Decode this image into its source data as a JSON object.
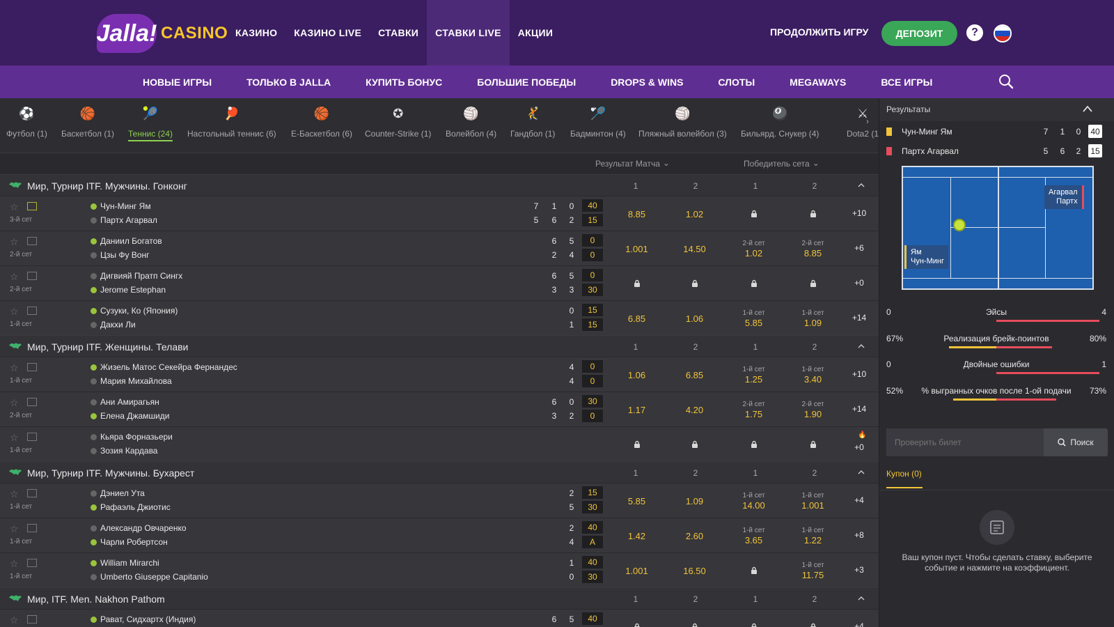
{
  "brand": {
    "logo_word": "Jalla!",
    "logo_casino": "CASINO"
  },
  "topnav": [
    "КАЗИНО",
    "КАЗИНО LIVE",
    "СТАВКИ",
    "СТАВКИ LIVE",
    "АКЦИИ"
  ],
  "header": {
    "continue": "ПРОДОЛЖИТЬ ИГРУ",
    "deposit": "ДЕПОЗИТ",
    "help": "?"
  },
  "subnav": [
    "НОВЫЕ ИГРЫ",
    "ТОЛЬКО В JALLA",
    "КУПИТЬ БОНУС",
    "БОЛЬШИЕ ПОБЕДЫ",
    "DROPS & WINS",
    "СЛОТЫ",
    "MEGAWAYS",
    "ВСЕ ИГРЫ"
  ],
  "sports": [
    {
      "label": "Футбол (1)",
      "icon": "⚽",
      "color": "#ffffff"
    },
    {
      "label": "Баскетбол (1)",
      "icon": "🏀",
      "color": "#e67e22"
    },
    {
      "label": "Теннис (24)",
      "icon": "🎾",
      "color": "#9ac43a"
    },
    {
      "label": "Настольный теннис (6)",
      "icon": "🏓",
      "color": "#e74c3c"
    },
    {
      "label": "Е-Баскетбол (6)",
      "icon": "🏀",
      "color": "#e67e22"
    },
    {
      "label": "Counter-Strike (1)",
      "icon": "✪",
      "color": "#dddddd"
    },
    {
      "label": "Волейбол (4)",
      "icon": "🏐",
      "color": "#3498db"
    },
    {
      "label": "Гандбол (1)",
      "icon": "🤾",
      "color": "#ffffff"
    },
    {
      "label": "Бадминтон (4)",
      "icon": "🏸",
      "color": "#ffffff"
    },
    {
      "label": "Пляжный волейбол (3)",
      "icon": "🏐",
      "color": "#f1c40f"
    },
    {
      "label": "Бильярд. Снукер (4)",
      "icon": "🎱",
      "color": "#e74c3c"
    },
    {
      "label": "Dota2 (1",
      "icon": "⚔",
      "color": "#dddddd"
    }
  ],
  "markets": {
    "match_result": "Результат Матча",
    "set_winner": "Победитель сета"
  },
  "cols": {
    "c1": "1",
    "c2": "2"
  },
  "tournaments": [
    {
      "name": "Мир, Турнир ITF. Мужчины. Гонконг",
      "matches": [
        {
          "set": "3-й сет",
          "p1": "Чун-Минг Ям",
          "p2": "Партх Агарвал",
          "s1": [
            "7",
            "1",
            "0"
          ],
          "s2": [
            "5",
            "6",
            "2"
          ],
          "pt1": "40",
          "pt2": "15",
          "serve": 1,
          "live": true,
          "odds": [
            {
              "v": "8.85"
            },
            {
              "v": "1.02"
            },
            {
              "lock": true
            },
            {
              "lock": true
            }
          ],
          "more": "+10"
        },
        {
          "set": "2-й сет",
          "p1": "Даниил Богатов",
          "p2": "Цзы Фу Вонг",
          "s1": [
            "6",
            "5"
          ],
          "s2": [
            "2",
            "4"
          ],
          "pt1": "0",
          "pt2": "0",
          "serve": 1,
          "odds": [
            {
              "v": "1.001"
            },
            {
              "v": "14.50"
            },
            {
              "sub": "2-й сет",
              "v": "1.02"
            },
            {
              "sub": "2-й сет",
              "v": "8.85"
            }
          ],
          "more": "+6"
        },
        {
          "set": "2-й сет",
          "p1": "Дигвияй Пратп Сингх",
          "p2": "Jerome Estephan",
          "s1": [
            "6",
            "5"
          ],
          "s2": [
            "3",
            "3"
          ],
          "pt1": "0",
          "pt2": "30",
          "serve": 2,
          "odds": [
            {
              "lock": true
            },
            {
              "lock": true
            },
            {
              "lock": true
            },
            {
              "lock": true
            }
          ],
          "more": "+0"
        },
        {
          "set": "1-й сет",
          "p1": "Сузуки, Ко (Япония)",
          "p2": "Дакхи Ли",
          "s1": [
            "0"
          ],
          "s2": [
            "1"
          ],
          "pt1": "15",
          "pt2": "15",
          "serve": 1,
          "odds": [
            {
              "v": "6.85"
            },
            {
              "v": "1.06"
            },
            {
              "sub": "1-й сет",
              "v": "5.85"
            },
            {
              "sub": "1-й сет",
              "v": "1.09"
            }
          ],
          "more": "+14"
        }
      ]
    },
    {
      "name": "Мир, Турнир ITF. Женщины. Телави",
      "matches": [
        {
          "set": "1-й сет",
          "p1": "Жизель Матос Секейра Фернандес",
          "p2": "Мария Михайлова",
          "s1": [
            "4"
          ],
          "s2": [
            "4"
          ],
          "pt1": "0",
          "pt2": "0",
          "serve": 1,
          "odds": [
            {
              "v": "1.06"
            },
            {
              "v": "6.85"
            },
            {
              "sub": "1-й сет",
              "v": "1.25"
            },
            {
              "sub": "1-й сет",
              "v": "3.40"
            }
          ],
          "more": "+10"
        },
        {
          "set": "2-й сет",
          "p1": "Ани Амирагьян",
          "p2": "Елена Джамшиди",
          "s1": [
            "6",
            "0"
          ],
          "s2": [
            "3",
            "2"
          ],
          "pt1": "30",
          "pt2": "0",
          "serve": 2,
          "odds": [
            {
              "v": "1.17"
            },
            {
              "v": "4.20"
            },
            {
              "sub": "2-й сет",
              "v": "1.75"
            },
            {
              "sub": "2-й сет",
              "v": "1.90"
            }
          ],
          "more": "+14"
        },
        {
          "set": "1-й сет",
          "p1": "Кьяра Форназьери",
          "p2": "Зозия Кардава",
          "s1": [],
          "s2": [],
          "pt1": "",
          "pt2": "",
          "serve": 0,
          "odds": [
            {
              "lock": true
            },
            {
              "lock": true
            },
            {
              "lock": true
            },
            {
              "lock": true
            }
          ],
          "more": "+0",
          "fire": true
        }
      ]
    },
    {
      "name": "Мир, Турнир ITF. Мужчины. Бухарест",
      "matches": [
        {
          "set": "1-й сет",
          "p1": "Дэниел Ута",
          "p2": "Рафаэль Джиотис",
          "s1": [
            "2"
          ],
          "s2": [
            "5"
          ],
          "pt1": "15",
          "pt2": "30",
          "serve": 2,
          "odds": [
            {
              "v": "5.85"
            },
            {
              "v": "1.09"
            },
            {
              "sub": "1-й сет",
              "v": "14.00"
            },
            {
              "sub": "1-й сет",
              "v": "1.001"
            }
          ],
          "more": "+4"
        },
        {
          "set": "1-й сет",
          "p1": "Александр Овчаренко",
          "p2": "Чарли Робертсон",
          "s1": [
            "2"
          ],
          "s2": [
            "4"
          ],
          "pt1": "40",
          "pt2": "A",
          "serve": 2,
          "odds": [
            {
              "v": "1.42"
            },
            {
              "v": "2.60"
            },
            {
              "sub": "1-й сет",
              "v": "3.65"
            },
            {
              "sub": "1-й сет",
              "v": "1.22"
            }
          ],
          "more": "+8"
        },
        {
          "set": "1-й сет",
          "p1": "William Mirarchi",
          "p2": "Umberto Giuseppe Capitanio",
          "s1": [
            "1"
          ],
          "s2": [
            "0"
          ],
          "pt1": "40",
          "pt2": "30",
          "serve": 1,
          "odds": [
            {
              "v": "1.001"
            },
            {
              "v": "16.50"
            },
            {
              "lock": true
            },
            {
              "sub": "1-й сет",
              "v": "11.75"
            }
          ],
          "more": "+3"
        }
      ]
    },
    {
      "name": "Мир, ITF. Men. Nakhon Pathom",
      "matches": [
        {
          "set": "",
          "p1": "Рават, Сидхартх (Индия)",
          "p2": "",
          "s1": [
            "6",
            "5"
          ],
          "s2": [],
          "pt1": "40",
          "pt2": "",
          "serve": 1,
          "odds": [
            {
              "lock": true
            },
            {
              "lock": true
            },
            {
              "lock": true
            },
            {
              "lock": true
            }
          ],
          "more": "+4"
        }
      ]
    }
  ],
  "results": {
    "title": "Результаты",
    "p1": {
      "name": "Чун-Минг Ям",
      "sets": [
        "7",
        "1",
        "0"
      ],
      "pt": "40",
      "color": "#f2c43a"
    },
    "p2": {
      "name": "Партх Агарвал",
      "sets": [
        "5",
        "6",
        "2"
      ],
      "pt": "15",
      "color": "#e74c5c"
    },
    "court": {
      "right_l1": "Агарвал",
      "right_l2": "Партх",
      "left_l1": "Ям",
      "left_l2": "Чун-Минг"
    },
    "stats": [
      {
        "label": "Эйсы",
        "l": "0",
        "r": "4",
        "lp": 0,
        "rp": 1
      },
      {
        "label": "Реализация брейк-поинтов",
        "l": "67%",
        "r": "80%",
        "lp": 0.46,
        "rp": 0.54
      },
      {
        "label": "Двойные ошибки",
        "l": "0",
        "r": "1",
        "lp": 0,
        "rp": 1
      },
      {
        "label": "% выгранных очков после 1-ой подачи",
        "l": "52%",
        "r": "73%",
        "lp": 0.42,
        "rp": 0.58
      }
    ]
  },
  "ticket": {
    "placeholder": "Проверить билет",
    "button": "Поиск"
  },
  "coupon": {
    "tab": "Купон (0)",
    "empty": "Ваш купон пуст. Чтобы сделать ставку, выберите событие и нажмите на коэффициент."
  },
  "colors": {
    "accent": "#f2c43a",
    "header": "#3b1d61",
    "subnav": "#5f2e92",
    "deposit": "#3aa657",
    "serve": "#9ac43a"
  }
}
